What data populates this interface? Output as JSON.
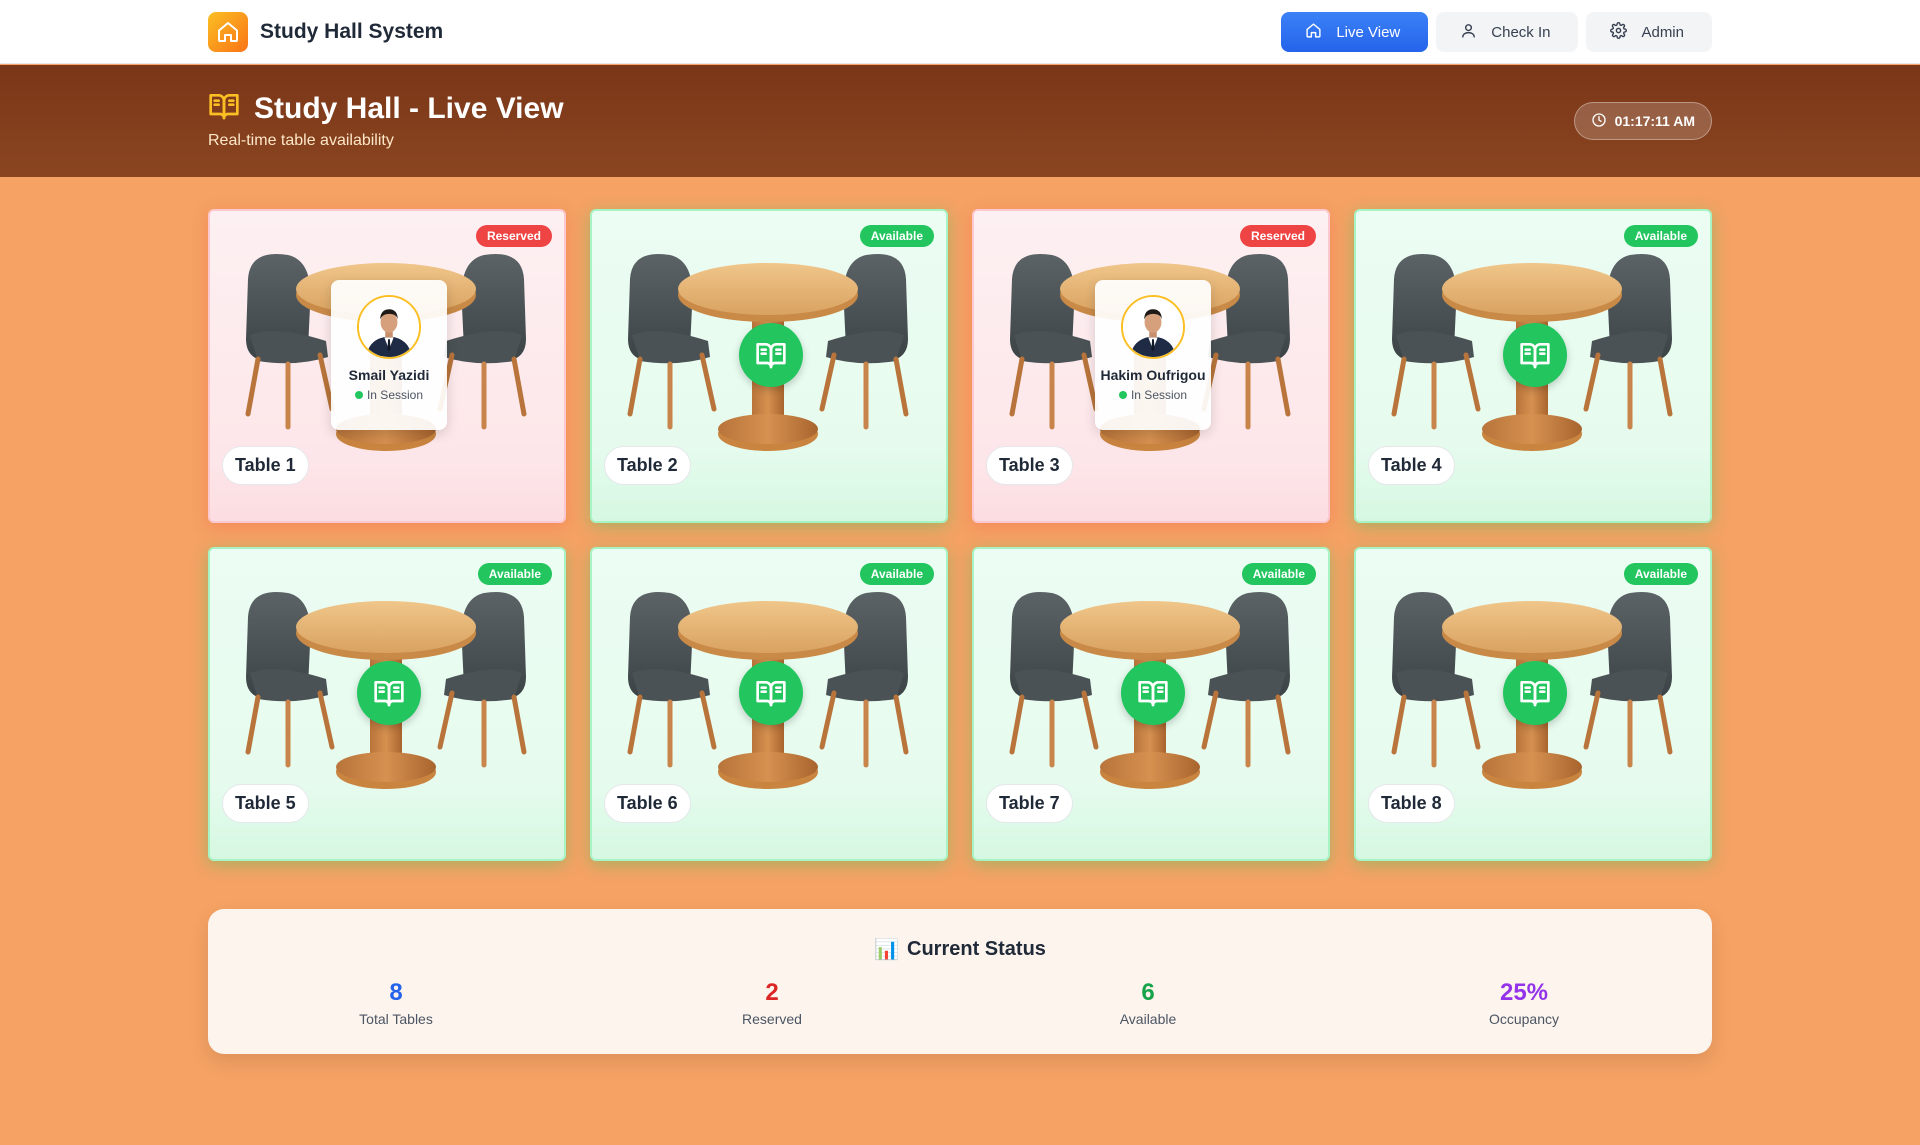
{
  "app": {
    "title": "Study Hall System",
    "logo_icon": "home-icon"
  },
  "nav": {
    "buttons": [
      {
        "label": "Live View",
        "icon": "home-icon",
        "active": true
      },
      {
        "label": "Check In",
        "icon": "user-icon",
        "active": false
      },
      {
        "label": "Admin",
        "icon": "gear-icon",
        "active": false
      }
    ]
  },
  "hero": {
    "title": "Study Hall - Live View",
    "subtitle": "Real-time table availability",
    "clock": "01:17:11 AM"
  },
  "tables": [
    {
      "label": "Table 1",
      "status": "Reserved",
      "state": "reserved",
      "occupant": {
        "name": "Smail Yazidi",
        "status": "In Session"
      }
    },
    {
      "label": "Table 2",
      "status": "Available",
      "state": "available"
    },
    {
      "label": "Table 3",
      "status": "Reserved",
      "state": "reserved",
      "occupant": {
        "name": "Hakim Oufrigou",
        "status": "In Session"
      }
    },
    {
      "label": "Table 4",
      "status": "Available",
      "state": "available"
    },
    {
      "label": "Table 5",
      "status": "Available",
      "state": "available"
    },
    {
      "label": "Table 6",
      "status": "Available",
      "state": "available"
    },
    {
      "label": "Table 7",
      "status": "Available",
      "state": "available"
    },
    {
      "label": "Table 8",
      "status": "Available",
      "state": "available"
    }
  ],
  "status": {
    "title_emoji": "📊",
    "title": "Current Status",
    "stats": [
      {
        "value": "8",
        "label": "Total Tables",
        "color": "#2563eb"
      },
      {
        "value": "2",
        "label": "Reserved",
        "color": "#dc2626"
      },
      {
        "value": "6",
        "label": "Available",
        "color": "#16a34a"
      },
      {
        "value": "25%",
        "label": "Occupancy",
        "color": "#9333ea"
      }
    ]
  },
  "colors": {
    "page_bg": "#f5a264",
    "hero_bg": "#7a3618",
    "available": "#22c55e",
    "reserved": "#ef4444",
    "accent_blue": "#2563eb"
  }
}
